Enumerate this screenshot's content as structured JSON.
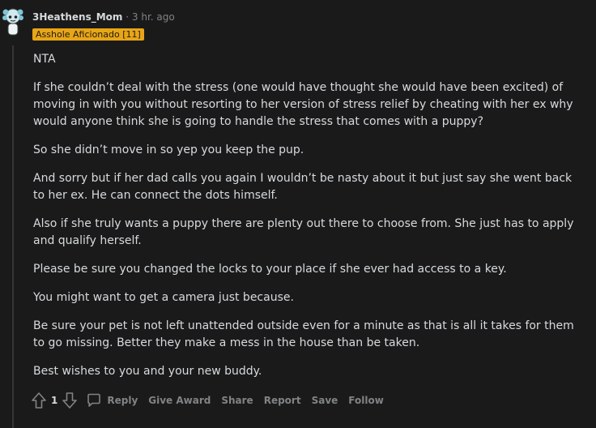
{
  "comment": {
    "author": "3Heathens_Mom",
    "separator": "·",
    "time": "3 hr. ago",
    "flair": "Asshole Aficionado [11]",
    "paragraphs": [
      "NTA",
      "If she couldn’t deal with the stress (one would have thought she would have been excited) of moving in with you without resorting to her version of stress relief by cheating with her ex why would anyone think she is going to handle the stress that comes with a puppy?",
      "So she didn’t move in so yep you keep the pup.",
      "And sorry but if her dad calls you again I wouldn’t be nasty about it but just say she went back to her ex. He can connect the dots himself.",
      "Also if she truly wants a puppy there are plenty out there to choose from. She just has to apply and qualify herself.",
      "Please be sure you changed the locks to your place if she ever had access to a key.",
      "You might want to get a camera just because.",
      "Be sure your pet is not left unattended outside even for a minute as that is all it takes for them to go missing. Better they make a mess in the house than be taken.",
      "Best wishes to you and your new buddy."
    ],
    "votes": "1",
    "actions": {
      "reply": "Reply",
      "give_award": "Give Award",
      "share": "Share",
      "report": "Report",
      "save": "Save",
      "follow": "Follow"
    }
  },
  "colors": {
    "background": "#1a1a1b",
    "text": "#d7dadc",
    "muted": "#818384",
    "flair_bg": "#e8a515",
    "thread_line": "#343536"
  },
  "icons": {
    "avatar": "snoo-avatar-icon",
    "upvote": "upvote-arrow-icon",
    "downvote": "downvote-arrow-icon",
    "reply": "comment-bubble-icon"
  }
}
